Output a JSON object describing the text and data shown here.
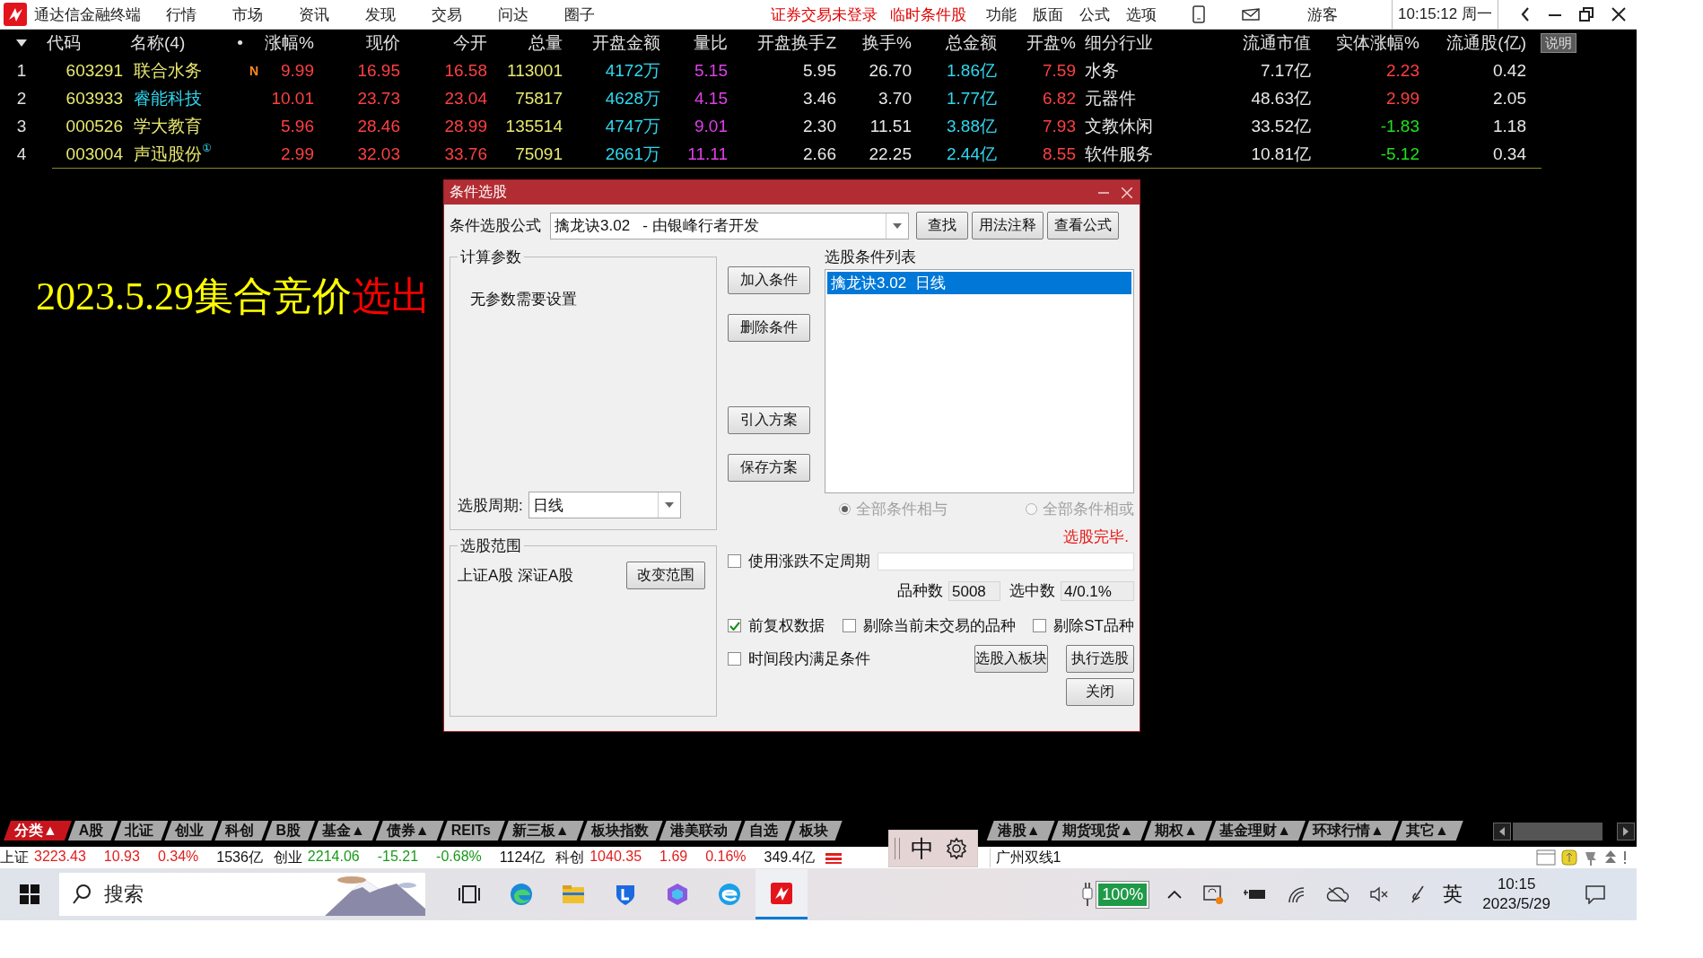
{
  "app_bar": {
    "title": "通达信金融终端",
    "menus": [
      "行情",
      "市场",
      "资讯",
      "发现",
      "交易",
      "问达",
      "圈子"
    ],
    "alerts": [
      "证券交易未登录",
      "临时条件股"
    ],
    "tools": [
      "功能",
      "版面",
      "公式",
      "选项"
    ],
    "user": "游客",
    "clock": "10:15:12 周一"
  },
  "quote_table": {
    "columns": [
      "代码",
      "名称(4)",
      "•",
      "涨幅%",
      "现价",
      "今开",
      "总量",
      "开盘金额",
      "量比",
      "开盘换手Z",
      "换手%",
      "总金额",
      "开盘%",
      "细分行业",
      "流通市值",
      "实体涨幅%",
      "流通股(亿)"
    ],
    "explain_button": "说明",
    "rows": [
      {
        "index": "1",
        "cells": [
          {
            "text": "603291",
            "color": "#e8e870"
          },
          {
            "text": "联合水务",
            "color": "#e8e870"
          },
          {
            "text": "N",
            "color": "#ff8a20"
          },
          {
            "text": "9.99",
            "color": "#ff4040"
          },
          {
            "text": "16.95",
            "color": "#ff4040"
          },
          {
            "text": "16.58",
            "color": "#ff4040"
          },
          {
            "text": "113001",
            "color": "#e8e870"
          },
          {
            "text": "4172万",
            "color": "#30d8f0"
          },
          {
            "text": "5.15",
            "color": "#e040e8"
          },
          {
            "text": "5.95",
            "color": "#e8e8e8"
          },
          {
            "text": "26.70",
            "color": "#e8e8e8"
          },
          {
            "text": "1.86亿",
            "color": "#30d8f0"
          },
          {
            "text": "7.59",
            "color": "#ff4040"
          },
          {
            "text": "水务",
            "color": "#e8e8e8"
          },
          {
            "text": "7.17亿",
            "color": "#e8e8e8"
          },
          {
            "text": "2.23",
            "color": "#ff4040"
          },
          {
            "text": "0.42",
            "color": "#e8e8e8"
          }
        ]
      },
      {
        "index": "2",
        "cells": [
          {
            "text": "603933",
            "color": "#e8e870"
          },
          {
            "text": "睿能科技",
            "color": "#30d8f0"
          },
          {
            "text": ""
          },
          {
            "text": "10.01",
            "color": "#ff4040"
          },
          {
            "text": "23.73",
            "color": "#ff4040"
          },
          {
            "text": "23.04",
            "color": "#ff4040"
          },
          {
            "text": "75817",
            "color": "#e8e870"
          },
          {
            "text": "4628万",
            "color": "#30d8f0"
          },
          {
            "text": "4.15",
            "color": "#e040e8"
          },
          {
            "text": "3.46",
            "color": "#e8e8e8"
          },
          {
            "text": "3.70",
            "color": "#e8e8e8"
          },
          {
            "text": "1.77亿",
            "color": "#30d8f0"
          },
          {
            "text": "6.82",
            "color": "#ff4040"
          },
          {
            "text": "元器件",
            "color": "#e8e8e8"
          },
          {
            "text": "48.63亿",
            "color": "#e8e8e8"
          },
          {
            "text": "2.99",
            "color": "#ff4040"
          },
          {
            "text": "2.05",
            "color": "#e8e8e8"
          }
        ]
      },
      {
        "index": "3",
        "cells": [
          {
            "text": "000526",
            "color": "#e8e870"
          },
          {
            "text": "学大教育",
            "color": "#e8e870"
          },
          {
            "text": ""
          },
          {
            "text": "5.96",
            "color": "#ff4040"
          },
          {
            "text": "28.46",
            "color": "#ff4040"
          },
          {
            "text": "28.99",
            "color": "#ff4040"
          },
          {
            "text": "135514",
            "color": "#e8e870"
          },
          {
            "text": "4747万",
            "color": "#30d8f0"
          },
          {
            "text": "9.01",
            "color": "#e040e8"
          },
          {
            "text": "2.30",
            "color": "#e8e8e8"
          },
          {
            "text": "11.51",
            "color": "#e8e8e8"
          },
          {
            "text": "3.88亿",
            "color": "#30d8f0"
          },
          {
            "text": "7.93",
            "color": "#ff4040"
          },
          {
            "text": "文教休闲",
            "color": "#e8e8e8"
          },
          {
            "text": "33.52亿",
            "color": "#e8e8e8"
          },
          {
            "text": "-1.83",
            "color": "#20e020"
          },
          {
            "text": "1.18",
            "color": "#e8e8e8"
          }
        ]
      },
      {
        "index": "4",
        "cells": [
          {
            "text": "003004",
            "color": "#e8e870"
          },
          {
            "text": "声迅股份$^{①}$",
            "color": "#e8e870"
          },
          {
            "text": ""
          },
          {
            "text": "2.99",
            "color": "#ff4040"
          },
          {
            "text": "32.03",
            "color": "#ff4040"
          },
          {
            "text": "33.76",
            "color": "#ff4040"
          },
          {
            "text": "75091",
            "color": "#e8e870"
          },
          {
            "text": "2661万",
            "color": "#30d8f0"
          },
          {
            "text": "11.11",
            "color": "#e040e8"
          },
          {
            "text": "2.66",
            "color": "#e8e8e8"
          },
          {
            "text": "22.25",
            "color": "#e8e8e8"
          },
          {
            "text": "2.44亿",
            "color": "#30d8f0"
          },
          {
            "text": "8.55",
            "color": "#ff4040"
          },
          {
            "text": "软件服务",
            "color": "#e8e8e8"
          },
          {
            "text": "10.81亿",
            "color": "#e8e8e8"
          },
          {
            "text": "-5.12",
            "color": "#20e020"
          },
          {
            "text": "0.34",
            "color": "#e8e8e8"
          }
        ]
      }
    ]
  },
  "annotation": {
    "parts": [
      {
        "text": "2023.5.29集合竞价",
        "color": "#ffff00"
      },
      {
        "text": "选出",
        "color": "#ff0000"
      }
    ]
  },
  "dialog": {
    "title": "条件选股",
    "formula_label": "条件选股公式",
    "formula": "擒龙诀3.02   - 由银峰行者开发",
    "formula_buttons": [
      "查找",
      "用法注释",
      "查看公式"
    ],
    "params": {
      "legend": "计算参数",
      "message": "无参数需要设置",
      "period_label": "选股周期:",
      "period": "日线"
    },
    "scope": {
      "legend": "选股范围",
      "markets": "上证A股 深证A股",
      "button": "改变范围"
    },
    "action_buttons": [
      "加入条件",
      "删除条件",
      "引入方案",
      "保存方案"
    ],
    "conditions": {
      "label": "选股条件列表",
      "items": [
        {
          "text": "擒龙诀3.02  日线",
          "selected": true
        }
      ]
    },
    "combine": [
      {
        "label": "全部条件相与",
        "selected": true
      },
      {
        "label": "全部条件相或",
        "selected": false
      }
    ],
    "combine_disabled": true,
    "status": "选股完毕.",
    "variable_period": {
      "label": "使用涨跌不定周期",
      "checked": false
    },
    "counts": [
      {
        "label": "品种数",
        "value": "5008"
      },
      {
        "label": "选中数",
        "value": "4/0.1%"
      }
    ],
    "options": [
      {
        "label": "前复权数据",
        "checked": true
      },
      {
        "label": "剔除当前未交易的品种",
        "checked": false
      },
      {
        "label": "剔除ST品种",
        "checked": false
      }
    ],
    "time_window": {
      "label": "时间段内满足条件",
      "checked": false
    },
    "run_buttons": [
      "选股入板块",
      "执行选股"
    ],
    "close_button": "关闭"
  },
  "market_tabs": [
    {
      "label": "分类▲",
      "selected": true
    },
    {
      "label": "A股",
      "selected": false
    },
    {
      "label": "北证",
      "selected": false
    },
    {
      "label": "创业",
      "selected": false
    },
    {
      "label": "科创",
      "selected": false
    },
    {
      "label": "B股",
      "selected": false
    },
    {
      "label": "基金▲",
      "selected": false
    },
    {
      "label": "债券▲",
      "selected": false
    },
    {
      "label": "REITs",
      "selected": false
    },
    {
      "label": "新三板▲",
      "selected": false
    },
    {
      "label": "板块指数",
      "selected": false
    },
    {
      "label": "港美联动",
      "selected": false
    },
    {
      "label": "自选",
      "selected": false
    },
    {
      "label": "板块",
      "selected": false
    },
    {
      "label": "港股▲",
      "selected": false
    },
    {
      "label": "期货现货▲",
      "selected": false
    },
    {
      "label": "期权▲",
      "selected": false
    },
    {
      "label": "基金理财▲",
      "selected": false
    },
    {
      "label": "环球行情▲",
      "selected": false
    },
    {
      "label": "其它▲",
      "selected": false
    }
  ],
  "index_bar": {
    "indices": [
      {
        "name": "上证",
        "value": "3223.43",
        "change": "10.93",
        "percent": "0.34%",
        "amount": "1536亿",
        "color": "#e02020"
      },
      {
        "name": "创业",
        "value": "2214.06",
        "change": "-15.21",
        "percent": "-0.68%",
        "amount": "1124亿",
        "color": "#1a9a1a"
      },
      {
        "name": "科创",
        "value": "1040.35",
        "change": "1.69",
        "percent": "0.16%",
        "amount": "349.4亿",
        "color": "#e02020"
      }
    ],
    "server": "广州双线1"
  },
  "ime_popup": {
    "mode": "中"
  },
  "taskbar": {
    "search_placeholder": "搜索",
    "battery": "100%",
    "language": "英",
    "time": "10:15",
    "date": "2023/5/29"
  }
}
